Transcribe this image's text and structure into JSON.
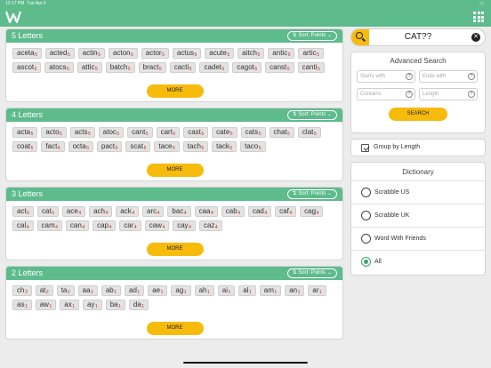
{
  "status": {
    "time": "12:17 PM",
    "date": "Tue Apr 6"
  },
  "sort_label": "Sort: Points",
  "more_label": "MORE",
  "sections": [
    {
      "title": "5 Letters",
      "tiles": [
        {
          "w": "aceta",
          "p": "5"
        },
        {
          "w": "acted",
          "p": "5"
        },
        {
          "w": "actin",
          "p": "5"
        },
        {
          "w": "acton",
          "p": "5"
        },
        {
          "w": "actor",
          "p": "5"
        },
        {
          "w": "actus",
          "p": "5"
        },
        {
          "w": "acute",
          "p": "5"
        },
        {
          "w": "aitch",
          "p": "5"
        },
        {
          "w": "antic",
          "p": "5"
        },
        {
          "w": "artic",
          "p": "5"
        },
        {
          "w": "ascot",
          "p": "5"
        },
        {
          "w": "atocs",
          "p": "5"
        },
        {
          "w": "attic",
          "p": "5"
        },
        {
          "w": "batch",
          "p": "5"
        },
        {
          "w": "bract",
          "p": "5"
        },
        {
          "w": "cacti",
          "p": "5"
        },
        {
          "w": "cadet",
          "p": "5"
        },
        {
          "w": "cagot",
          "p": "5"
        },
        {
          "w": "canst",
          "p": "5"
        },
        {
          "w": "canti",
          "p": "5"
        }
      ]
    },
    {
      "title": "4 Letters",
      "tiles": [
        {
          "w": "acta",
          "p": "5"
        },
        {
          "w": "acto",
          "p": "5"
        },
        {
          "w": "acts",
          "p": "5"
        },
        {
          "w": "atoc",
          "p": "5"
        },
        {
          "w": "cant",
          "p": "5"
        },
        {
          "w": "cart",
          "p": "5"
        },
        {
          "w": "cast",
          "p": "5"
        },
        {
          "w": "cate",
          "p": "5"
        },
        {
          "w": "cats",
          "p": "5"
        },
        {
          "w": "chat",
          "p": "5"
        },
        {
          "w": "clat",
          "p": "5"
        },
        {
          "w": "coat",
          "p": "5"
        },
        {
          "w": "fact",
          "p": "5"
        },
        {
          "w": "octa",
          "p": "5"
        },
        {
          "w": "pact",
          "p": "5"
        },
        {
          "w": "scat",
          "p": "5"
        },
        {
          "w": "tace",
          "p": "5"
        },
        {
          "w": "tach",
          "p": "5"
        },
        {
          "w": "tack",
          "p": "5"
        },
        {
          "w": "taco",
          "p": "5"
        }
      ]
    },
    {
      "title": "3 Letters",
      "tiles": [
        {
          "w": "act",
          "p": "5"
        },
        {
          "w": "cat",
          "p": "5"
        },
        {
          "w": "ace",
          "p": "4"
        },
        {
          "w": "ach",
          "p": "4"
        },
        {
          "w": "ack",
          "p": "4"
        },
        {
          "w": "arc",
          "p": "4"
        },
        {
          "w": "bac",
          "p": "4"
        },
        {
          "w": "caa",
          "p": "4"
        },
        {
          "w": "cab",
          "p": "4"
        },
        {
          "w": "cad",
          "p": "4"
        },
        {
          "w": "caf",
          "p": "4"
        },
        {
          "w": "cag",
          "p": "4"
        },
        {
          "w": "cal",
          "p": "4"
        },
        {
          "w": "cam",
          "p": "4"
        },
        {
          "w": "can",
          "p": "4"
        },
        {
          "w": "cap",
          "p": "4"
        },
        {
          "w": "car",
          "p": "4"
        },
        {
          "w": "caw",
          "p": "4"
        },
        {
          "w": "cay",
          "p": "4"
        },
        {
          "w": "caz",
          "p": "4"
        }
      ]
    },
    {
      "title": "2 Letters",
      "tiles": [
        {
          "w": "ch",
          "p": "3"
        },
        {
          "w": "at",
          "p": "2"
        },
        {
          "w": "ta",
          "p": "2"
        },
        {
          "w": "aa",
          "p": "1"
        },
        {
          "w": "ab",
          "p": "1"
        },
        {
          "w": "ad",
          "p": "1"
        },
        {
          "w": "ae",
          "p": "1"
        },
        {
          "w": "ag",
          "p": "1"
        },
        {
          "w": "ah",
          "p": "1"
        },
        {
          "w": "ai",
          "p": "1"
        },
        {
          "w": "al",
          "p": "1"
        },
        {
          "w": "am",
          "p": "1"
        },
        {
          "w": "an",
          "p": "1"
        },
        {
          "w": "ar",
          "p": "1"
        },
        {
          "w": "as",
          "p": "1"
        },
        {
          "w": "aw",
          "p": "1"
        },
        {
          "w": "ax",
          "p": "1"
        },
        {
          "w": "ay",
          "p": "1"
        },
        {
          "w": "ba",
          "p": "1"
        },
        {
          "w": "da",
          "p": "1"
        }
      ]
    }
  ],
  "search": {
    "value": "CAT??"
  },
  "advanced": {
    "title": "Advanced Search",
    "starts_with": "Starts with",
    "ends_with": "Ends with",
    "contains": "Contains",
    "length": "Length",
    "button": "SEARCH"
  },
  "group_by_length": {
    "label": "Group by Length",
    "checked": true
  },
  "dictionary": {
    "title": "Dictionary",
    "options": [
      {
        "label": "Scrabble US",
        "selected": false
      },
      {
        "label": "Scrabble UK",
        "selected": false
      },
      {
        "label": "Word With Friends",
        "selected": false
      },
      {
        "label": "All",
        "selected": true
      }
    ]
  },
  "colors": {
    "accent": "#5dbb8c",
    "button": "#f7bb0b",
    "points": "#d22222"
  }
}
